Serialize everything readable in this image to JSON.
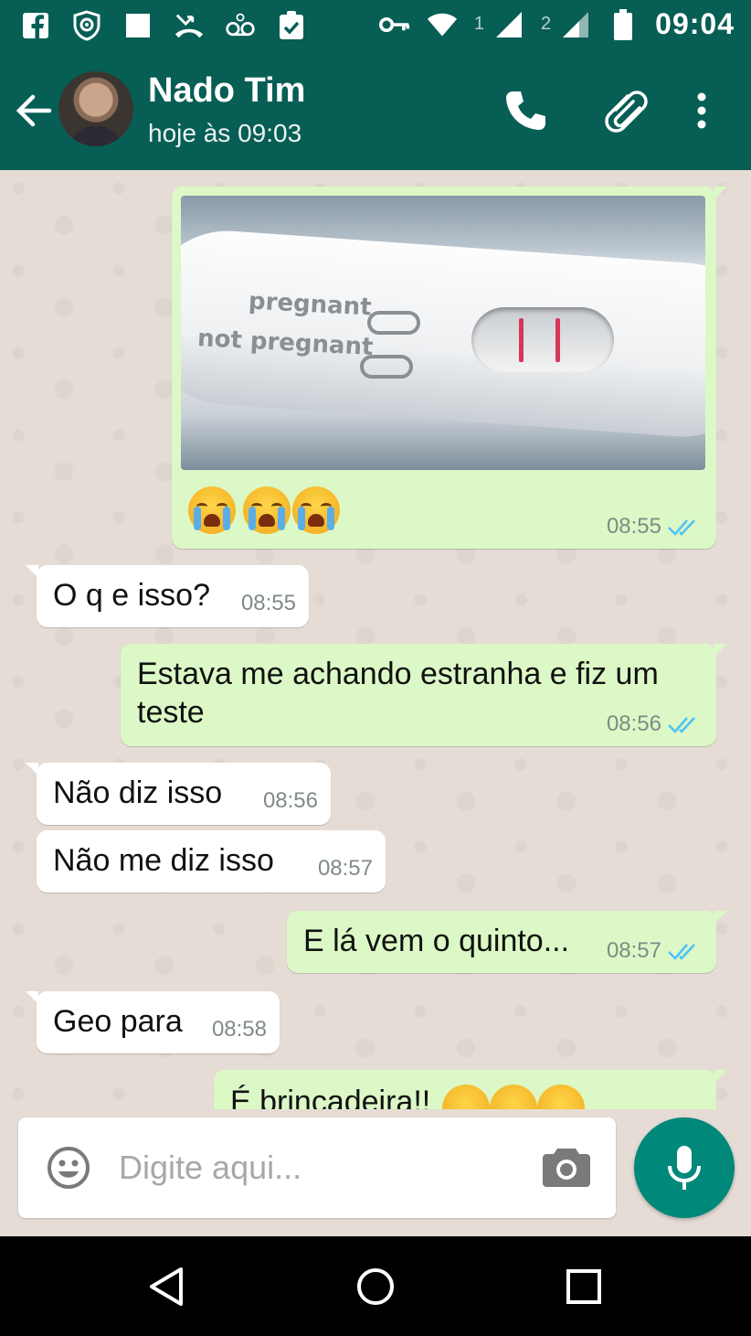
{
  "status_bar": {
    "time": "09:04",
    "sim1": "1",
    "sim2": "2",
    "icons": [
      "facebook-icon",
      "shield-icon",
      "square-icon",
      "missed-call-icon",
      "voicemail-icon",
      "clipboard-check-icon",
      "vpn-key-icon",
      "wifi-icon",
      "signal-icon",
      "signal-icon",
      "battery-icon"
    ]
  },
  "header": {
    "contact_name": "Nado Tim",
    "last_seen": "hoje às 09:03"
  },
  "messages": [
    {
      "direction": "out",
      "kind": "photo",
      "photo_labels": [
        "pregnant",
        "not pregnant"
      ],
      "emoji_count": 3,
      "time": "08:55",
      "status": "read"
    },
    {
      "direction": "in",
      "text": "O q e isso?",
      "time": "08:55"
    },
    {
      "direction": "out",
      "text_line1": "Estava me achando estranha e fiz um",
      "text_line2": "teste",
      "time": "08:56",
      "status": "read"
    },
    {
      "direction": "in",
      "text": "Não diz isso",
      "time": "08:56"
    },
    {
      "direction": "in",
      "text": "Não me diz isso",
      "time": "08:57"
    },
    {
      "direction": "out",
      "text": "E lá vem o quinto...",
      "time": "08:57",
      "status": "read"
    },
    {
      "direction": "in",
      "text": "Geo para",
      "time": "08:58"
    },
    {
      "direction": "out",
      "text": "É brincadeira!!",
      "partially_visible": true
    }
  ],
  "composer": {
    "placeholder": "Digite aqui..."
  },
  "colors": {
    "toolbar": "#075e54",
    "outgoing_bubble": "#dcf8c6",
    "incoming_bubble": "#ffffff",
    "chat_bg": "#e5ddd5",
    "fab": "#00897b",
    "read_ticks": "#4fc3f7"
  }
}
